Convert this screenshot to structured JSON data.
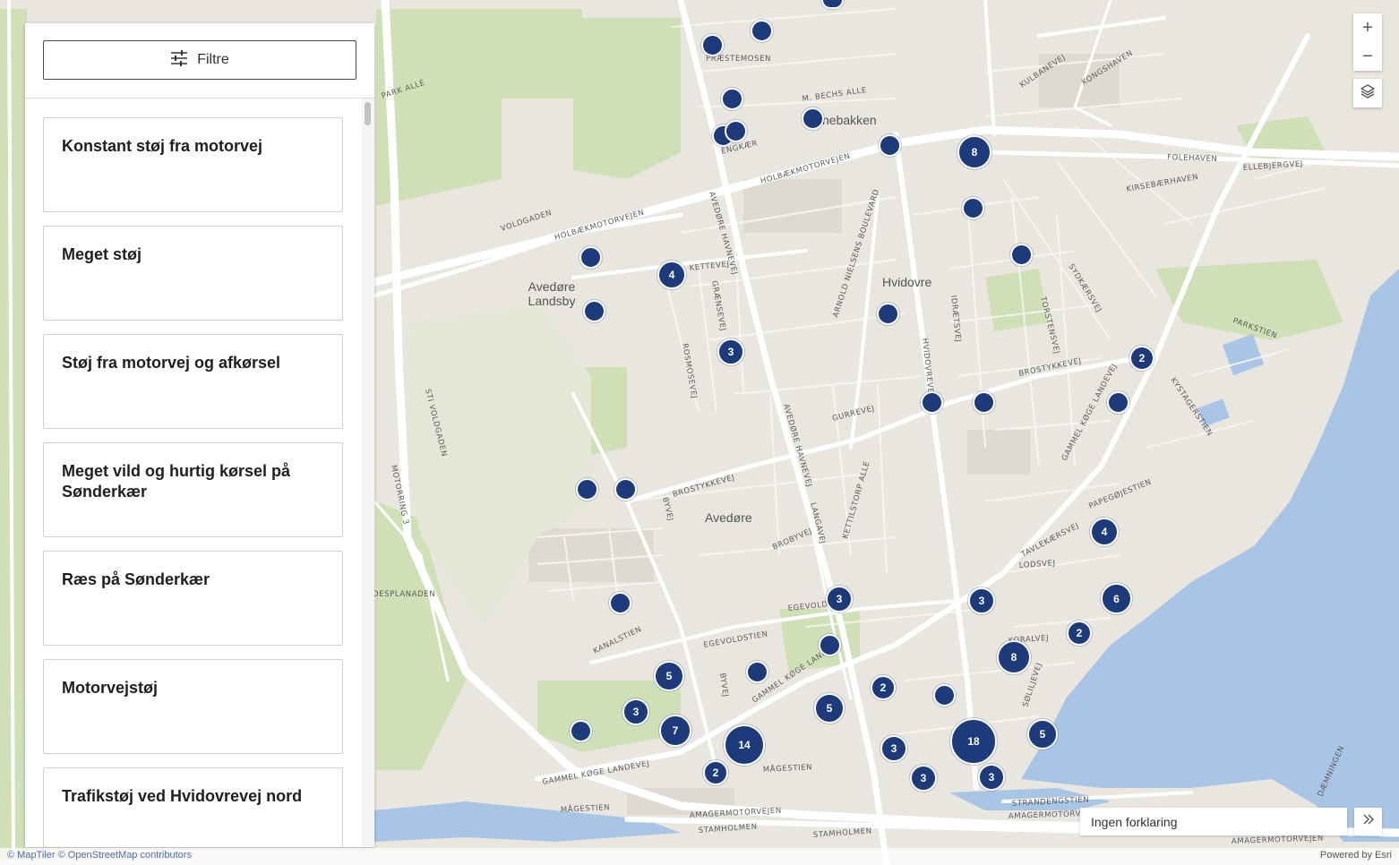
{
  "panel": {
    "filter_label": "Filtre",
    "items": [
      {
        "title": "Konstant støj fra motorvej"
      },
      {
        "title": "Meget støj"
      },
      {
        "title": "Støj fra motorvej og afkørsel"
      },
      {
        "title": "Meget vild og hurtig kørsel på Sønderkær"
      },
      {
        "title": "Ræs på Sønderkær"
      },
      {
        "title": "Motorvejstøj"
      },
      {
        "title": "Trafikstøj ved Hvidovrevej nord"
      }
    ]
  },
  "map": {
    "places": [
      "Hvidovre",
      "Avedøre",
      "Avedøre Landsby",
      "nebakken"
    ],
    "roads": [
      "HOLBÆKMOTORVEJEN",
      "VOLDGADEN",
      "KETTEVEJ",
      "AVEDØRE HAVNEVEJ",
      "ARNOLD NIELSENS BOULEVARD",
      "HVIDOVREVEJ",
      "IDRÆTSVEJ",
      "BROSTYKKEVEJ",
      "GURREVEJ",
      "GAMMEL KØGE LANDEVEJ",
      "EGEVOLDSTIEN",
      "KANALSTIEN",
      "AMAGERMOTORVEJEN",
      "STRANDENGSTIEN",
      "FOLEHAVEN",
      "ELLEBJERGVEJ",
      "KYSTAGERSTIEN",
      "PAPEGØJESTIEN",
      "TAVLEKÆRSVEJ",
      "LODSVEJ",
      "KORALVEJ",
      "MOTORRING 3",
      "STI VOLDGADEN",
      "BYVEJ",
      "BROBYVEJ",
      "KETTILSTORP ALLE",
      "LANGAVEJ",
      "ROSMOSEVEJ",
      "PARK ALLÉ",
      "PRÆSTEMOSEN",
      "M. BECHS ALLE",
      "ENGKÆR",
      "STAMHOLMEN",
      "MÅGESTIEN",
      "KULBANEVEJ",
      "KONGSHAVEN",
      "KIRSEBÆRHAVEN",
      "SYDKÆRSVEJ",
      "TORSTENSVEJ",
      "PARKSTIEN",
      "DÆMNINGEN",
      "SØLILJEVEJ",
      "DESPLANADEN"
    ],
    "clusters": [
      {
        "count": "8"
      },
      {
        "count": "4"
      },
      {
        "count": "3"
      },
      {
        "count": "2"
      },
      {
        "count": "4"
      },
      {
        "count": "3"
      },
      {
        "count": "3"
      },
      {
        "count": "6"
      },
      {
        "count": "2"
      },
      {
        "count": "8"
      },
      {
        "count": "5"
      },
      {
        "count": "3"
      },
      {
        "count": "7"
      },
      {
        "count": "14"
      },
      {
        "count": "2"
      },
      {
        "count": "2"
      },
      {
        "count": "5"
      },
      {
        "count": "3"
      },
      {
        "count": "3"
      },
      {
        "count": "18"
      },
      {
        "count": "3"
      },
      {
        "count": "5"
      }
    ]
  },
  "controls": {
    "zoom_in": "+",
    "zoom_out": "−",
    "legend_text": "Ingen forklaring"
  },
  "attribution": {
    "maptiler": "© MapTiler",
    "osm": "© OpenStreetMap contributors",
    "powered": "Powered by Esri"
  },
  "colors": {
    "marker": "#1d3a7a",
    "water": "#a9c5e6",
    "green": "#cfe0b6",
    "road": "#ffffff",
    "land": "#e9e6df"
  }
}
